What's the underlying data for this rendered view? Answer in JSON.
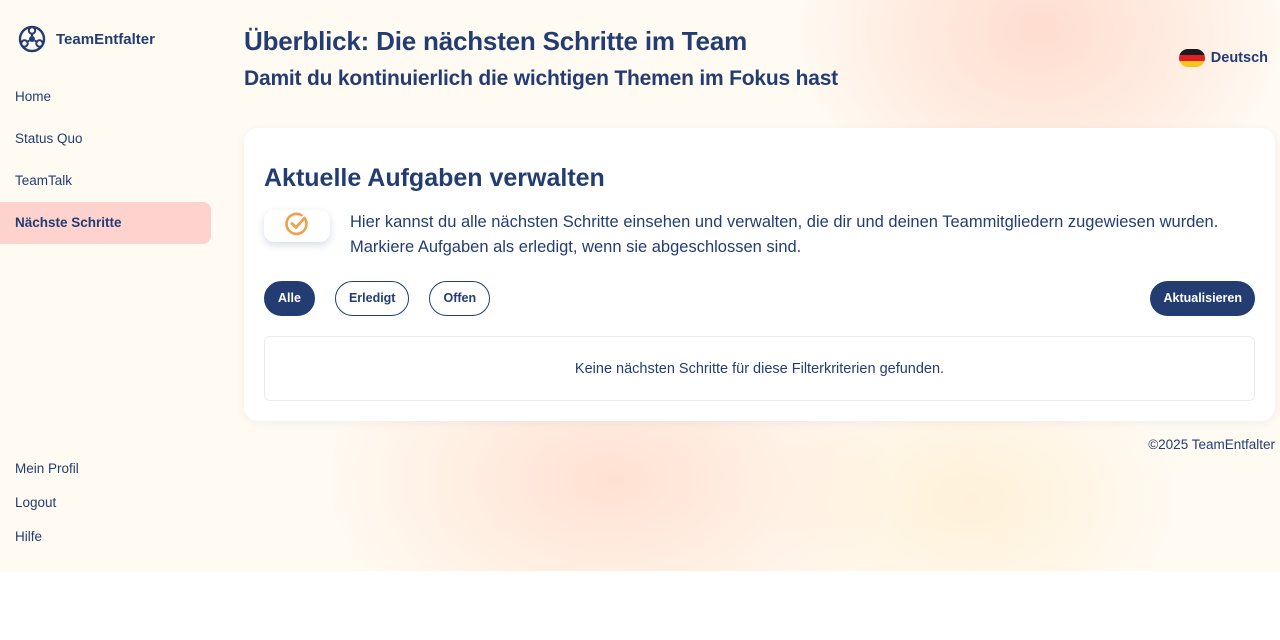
{
  "brand": {
    "name": "TeamEntfalter",
    "logo_icon": "teamentfalter-logo-icon"
  },
  "sidebar": {
    "items": [
      {
        "label": "Home",
        "active": false
      },
      {
        "label": "Status Quo",
        "active": false
      },
      {
        "label": "TeamTalk",
        "active": false
      },
      {
        "label": "Nächste Schritte",
        "active": true
      }
    ],
    "bottom_items": [
      {
        "label": "Mein Profil"
      },
      {
        "label": "Logout"
      },
      {
        "label": "Hilfe"
      }
    ]
  },
  "header": {
    "title": "Überblick: Die nächsten Schritte im Team",
    "subtitle": "Damit du kontinuierlich die wichtigen Themen im Fokus hast"
  },
  "language": {
    "label": "Deutsch",
    "flag_icon": "german-flag-icon"
  },
  "card": {
    "title": "Aktuelle Aufgaben verwalten",
    "info_icon": "check-circle-icon",
    "info_text": "Hier kannst du alle nächsten Schritte einsehen und verwalten, die dir und deinen Teammitgliedern zugewiesen wurden. Markiere Aufgaben als erledigt, wenn sie abgeschlossen sind.",
    "filters": [
      {
        "label": "Alle",
        "active": true
      },
      {
        "label": "Erledigt",
        "active": false
      },
      {
        "label": "Offen",
        "active": false
      }
    ],
    "refresh_label": "Aktualisieren",
    "empty_message": "Keine nächsten Schritte für diese Filterkriterien gefunden."
  },
  "footer": {
    "text": "©2025 TeamEntfalter"
  },
  "colors": {
    "primary": "#233d73",
    "active_nav_bg": "#ffd3cd",
    "page_bg": "#fffaf2",
    "accent_orange": "#f0a04b"
  }
}
